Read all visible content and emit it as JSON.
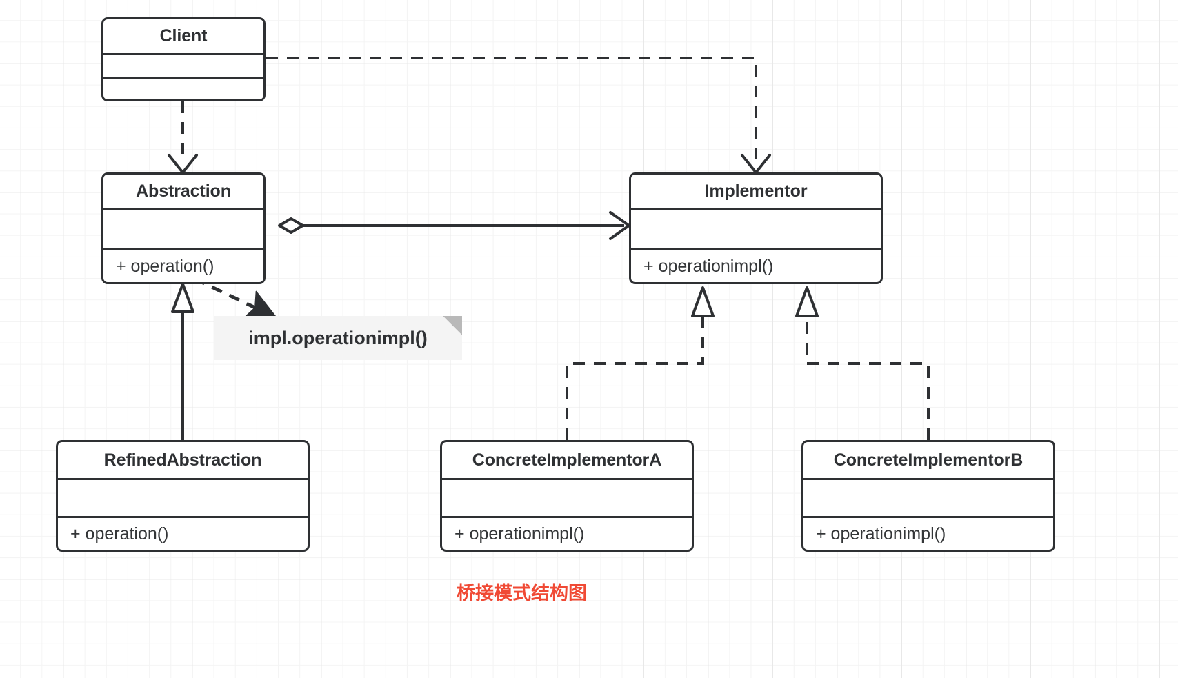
{
  "diagram": {
    "title": "桥接模式结构图",
    "title_color": "#f04a35",
    "stroke_color": "#2e3033",
    "note_bg": "#f4f4f4",
    "classes": [
      {
        "id": "client",
        "name": "Client",
        "attributes": "",
        "operations": ""
      },
      {
        "id": "abstraction",
        "name": "Abstraction",
        "attributes": "",
        "operations": "+ operation()"
      },
      {
        "id": "implementor",
        "name": "Implementor",
        "attributes": "",
        "operations": "+ operationimpl()"
      },
      {
        "id": "refined-abstraction",
        "name": "RefinedAbstraction",
        "attributes": "",
        "operations": "+ operation()"
      },
      {
        "id": "concrete-implementor-a",
        "name": "ConcreteImplementorA",
        "attributes": "",
        "operations": "+ operationimpl()"
      },
      {
        "id": "concrete-implementor-b",
        "name": "ConcreteImplementorB",
        "attributes": "",
        "operations": "+ operationimpl()"
      }
    ],
    "note": {
      "text": "impl.operationimpl()"
    },
    "relationships": [
      {
        "from": "Client",
        "to": "Abstraction",
        "type": "dependency",
        "line": "dashed",
        "arrow": "open"
      },
      {
        "from": "Client",
        "to": "Implementor",
        "type": "dependency",
        "line": "dashed",
        "arrow": "open"
      },
      {
        "from": "Abstraction",
        "to": "Implementor",
        "type": "aggregation",
        "line": "solid",
        "arrow": "open",
        "source_decoration": "hollow-diamond"
      },
      {
        "from": "RefinedAbstraction",
        "to": "Abstraction",
        "type": "generalization",
        "line": "solid",
        "arrow": "hollow-triangle"
      },
      {
        "from": "ConcreteImplementorA",
        "to": "Implementor",
        "type": "realization",
        "line": "dashed",
        "arrow": "hollow-triangle"
      },
      {
        "from": "ConcreteImplementorB",
        "to": "Implementor",
        "type": "realization",
        "line": "dashed",
        "arrow": "hollow-triangle"
      },
      {
        "from": "Abstraction.operation()",
        "to": "note",
        "type": "note-anchor",
        "line": "dashed",
        "arrow": "solid-arrow"
      }
    ]
  }
}
